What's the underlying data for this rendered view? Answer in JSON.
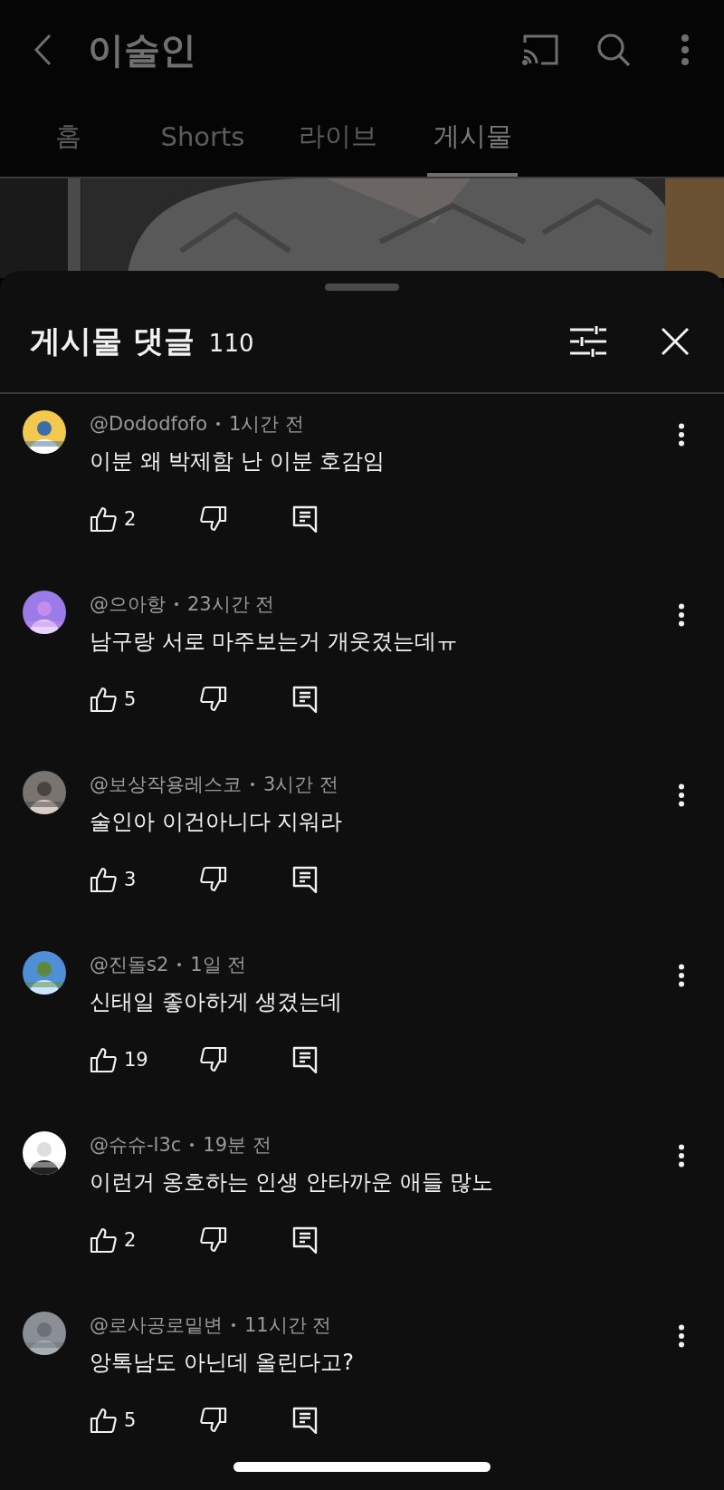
{
  "app_bar": {
    "title": "이술인"
  },
  "tabs": [
    {
      "label": "홈",
      "selected": false
    },
    {
      "label": "Shorts",
      "selected": false
    },
    {
      "label": "라이브",
      "selected": false
    },
    {
      "label": "게시물",
      "selected": true
    }
  ],
  "comments_sheet": {
    "title": "게시물 댓글",
    "count": "110",
    "comments": [
      {
        "author": "@Dododfofo",
        "time": "1시간 전",
        "text": "이분 왜 박제함 난 이분 호감임",
        "likes": "2"
      },
      {
        "author": "@으아항",
        "time": "23시간 전",
        "text": "남구랑 서로 마주보는거 개웃겼는데ㅠ",
        "likes": "5"
      },
      {
        "author": "@보상작용레스코",
        "time": "3시간 전",
        "text": "술인아 이건아니다 지워라",
        "likes": "3"
      },
      {
        "author": "@진돌s2",
        "time": "1일 전",
        "text": "신태일 좋아하게 생겼는데",
        "likes": "19"
      },
      {
        "author": "@슈슈-l3c",
        "time": "19분 전",
        "text": "이런거 옹호하는 인생 안타까운 애들 많노",
        "likes": "2"
      },
      {
        "author": "@로사공로밑변",
        "time": "11시간 전",
        "text": "앙톡남도 아닌데 올린다고?",
        "likes": "5"
      }
    ]
  }
}
